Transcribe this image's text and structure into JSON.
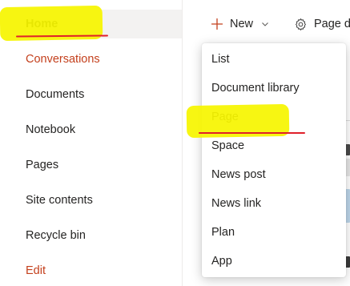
{
  "sidebar": {
    "items": [
      {
        "label": "Home",
        "selected": true
      },
      {
        "label": "Conversations"
      },
      {
        "label": "Documents"
      },
      {
        "label": "Notebook"
      },
      {
        "label": "Pages"
      },
      {
        "label": "Site contents"
      },
      {
        "label": "Recycle bin"
      },
      {
        "label": "Edit"
      }
    ]
  },
  "command_bar": {
    "new_label": "New",
    "page_details_label": "Page de"
  },
  "new_menu": {
    "items": [
      {
        "label": "List"
      },
      {
        "label": "Document library"
      },
      {
        "label": "Page"
      },
      {
        "label": "Space"
      },
      {
        "label": "News post"
      },
      {
        "label": "News link"
      },
      {
        "label": "Plan"
      },
      {
        "label": "App"
      }
    ]
  },
  "colors": {
    "accent": "#c4401d",
    "highlight": "#f6f500",
    "annotation_underline": "#e0202a",
    "selected_bg": "#f3f2f1"
  }
}
